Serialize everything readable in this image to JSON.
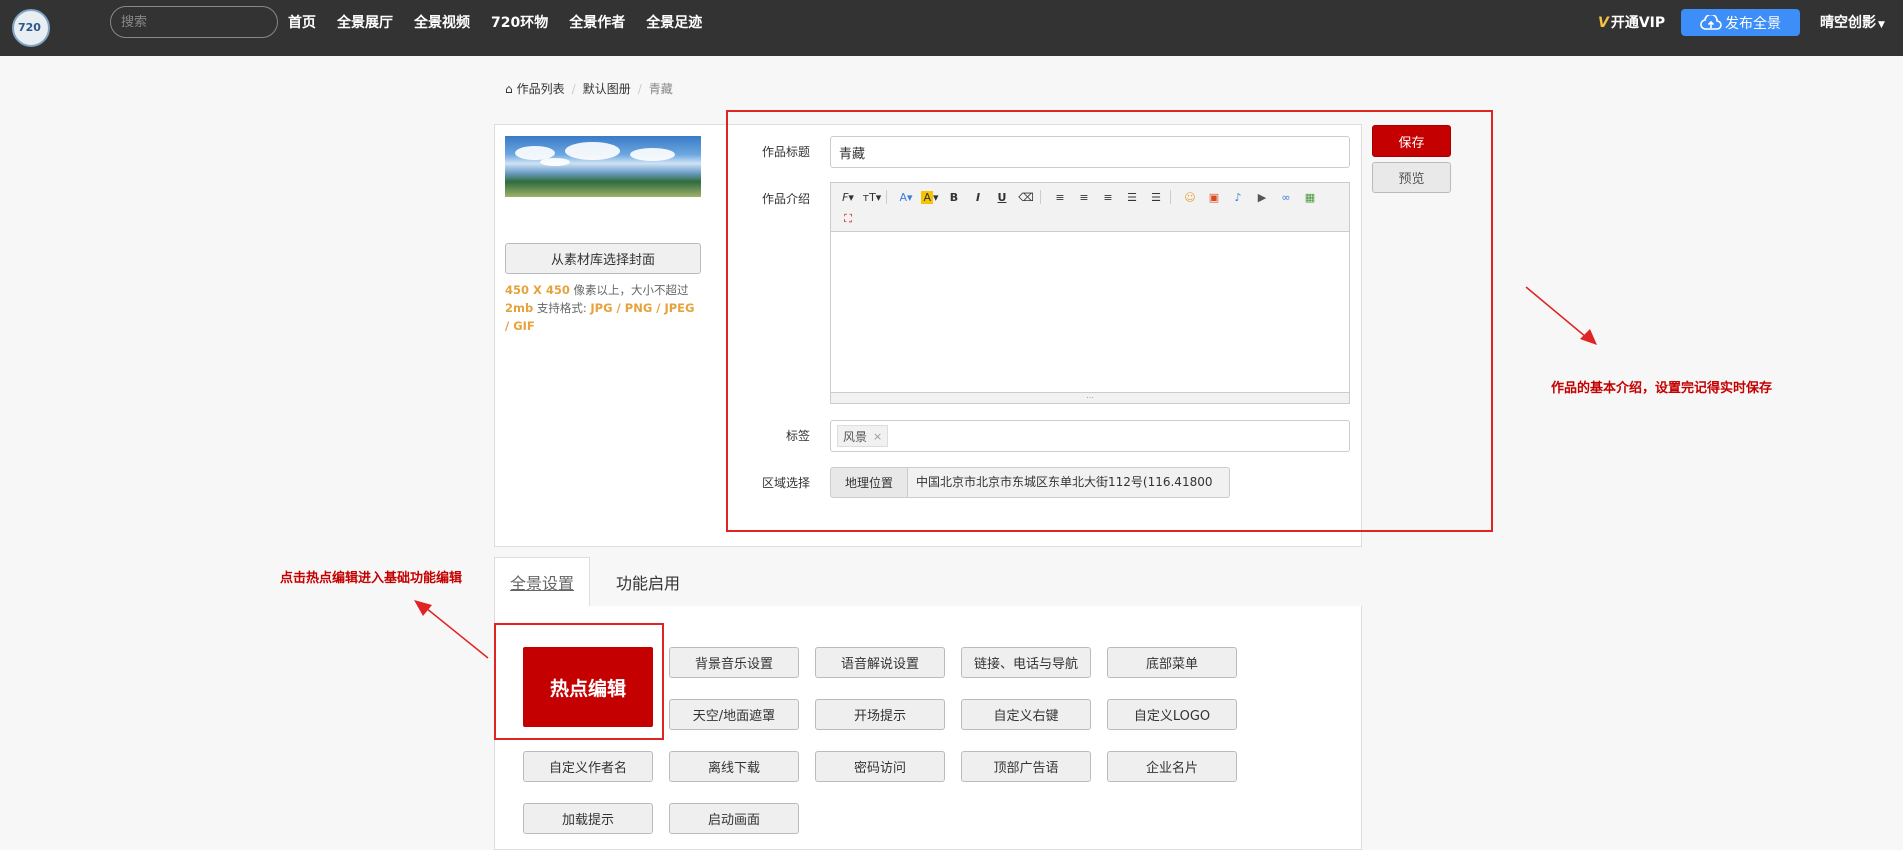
{
  "nav": {
    "search_placeholder": "搜索",
    "items": [
      "首页",
      "全景展厅",
      "全景视频",
      "720环物",
      "全景作者",
      "全景足迹"
    ],
    "vip": "开通VIP",
    "publish": "发布全景",
    "user": "晴空创影"
  },
  "breadcrumb": {
    "home": "作品列表",
    "album": "默认图册",
    "current": "青藏"
  },
  "cover": {
    "button": "从素材库选择封面",
    "hint_size": "450 X 450",
    "hint_text1": " 像素以上，大小不超过",
    "hint_limit": "2mb",
    "hint_text2": " 支持格式: ",
    "hint_formats": "JPG / PNG / JPEG / GIF"
  },
  "form": {
    "title_label": "作品标题",
    "title_value": "青藏",
    "intro_label": "作品介绍",
    "tags_label": "标签",
    "tag": "风景",
    "tag_remove": "×",
    "region_label": "区域选择",
    "region_button": "地理位置",
    "region_value": "中国北京市北京市东城区东单北大街112号(116.41800"
  },
  "actions": {
    "save": "保存",
    "preview": "预览"
  },
  "annotations": {
    "right": "作品的基本介绍，设置完记得实时保存",
    "left": "点击热点编辑进入基础功能编辑"
  },
  "tabs": [
    "全景设置",
    "功能启用"
  ],
  "features": {
    "hotspot": "热点编辑",
    "buttons": [
      "背景音乐设置",
      "语音解说设置",
      "链接、电话与导航",
      "底部菜单",
      "天空/地面遮罩",
      "开场提示",
      "自定义右键",
      "自定义LOGO",
      "自定义作者名",
      "离线下载",
      "密码访问",
      "顶部广告语",
      "企业名片",
      "加载提示",
      "启动画面"
    ]
  },
  "colors": {
    "topbar": "#333333",
    "accent_red": "#c40000",
    "publish_blue": "#3d8ef8",
    "annotation_red": "#e02424",
    "hint_orange": "#e6a23c"
  }
}
